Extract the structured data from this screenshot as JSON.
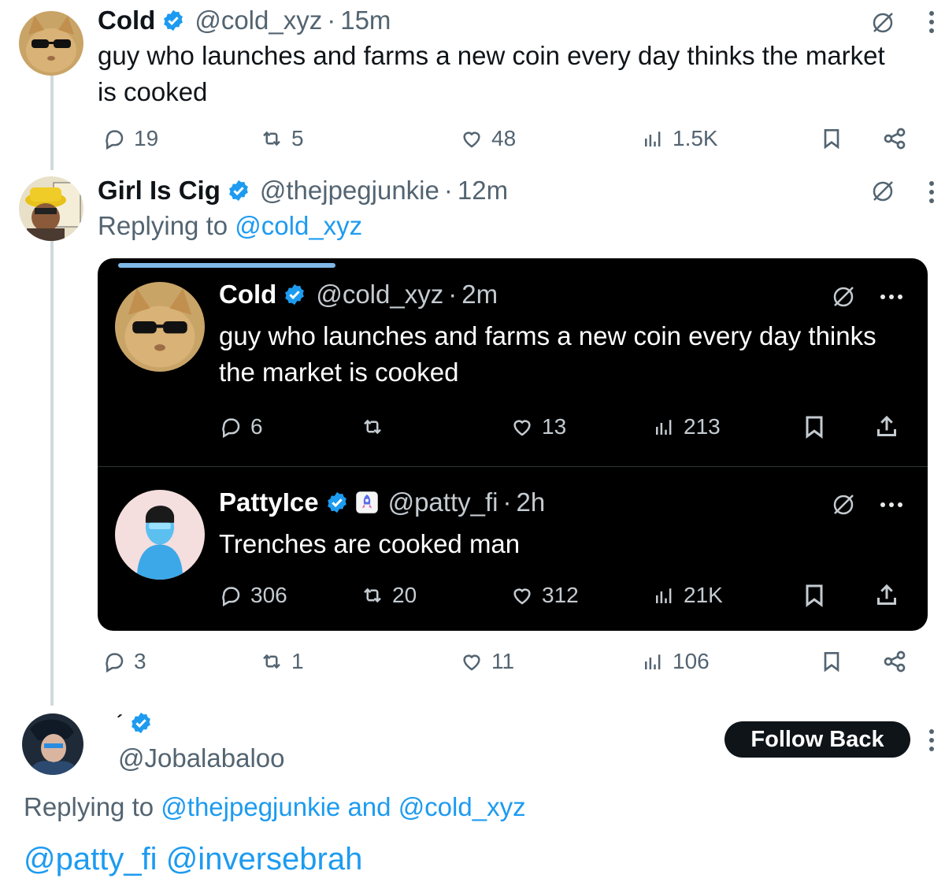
{
  "tweet1": {
    "name": "Cold",
    "handle": "@cold_xyz",
    "time": "15m",
    "text": "guy who launches and farms a new coin every day thinks the market is cooked",
    "replies": "19",
    "reposts": "5",
    "likes": "48",
    "views": "1.5K"
  },
  "tweet2": {
    "name": "Girl Is Cig",
    "handle": "@thejpegjunkie",
    "time": "12m",
    "replying_prefix": "Replying to",
    "replying_to": "@cold_xyz",
    "replies": "3",
    "reposts": "1",
    "likes": "11",
    "views": "106"
  },
  "card": {
    "post1": {
      "name": "Cold",
      "handle": "@cold_xyz",
      "time": "2m",
      "text": "guy who launches and farms a new coin every day thinks the market is cooked",
      "replies": "6",
      "reposts": "",
      "likes": "13",
      "views": "213"
    },
    "post2": {
      "name": "PattyIce",
      "handle": "@patty_fi",
      "time": "2h",
      "text": "Trenches are cooked man",
      "replies": "306",
      "reposts": "20",
      "likes": "312",
      "views": "21K"
    }
  },
  "tweet3": {
    "name": "´",
    "handle": "@Jobalabaloo",
    "follow_label": "Follow Back",
    "replying_prefix": "Replying to",
    "replying_user1": "@thejpegjunkie",
    "replying_and": "and",
    "replying_user2": "@cold_xyz",
    "text_mention1": "@patty_fi",
    "text_mention2": "@inversebrah"
  },
  "colors": {
    "accent": "#1d9bf0",
    "text": "#0f1419",
    "muted": "#536471",
    "card_bg": "#000000",
    "follow_bg": "#0f1419"
  },
  "separator": "·"
}
